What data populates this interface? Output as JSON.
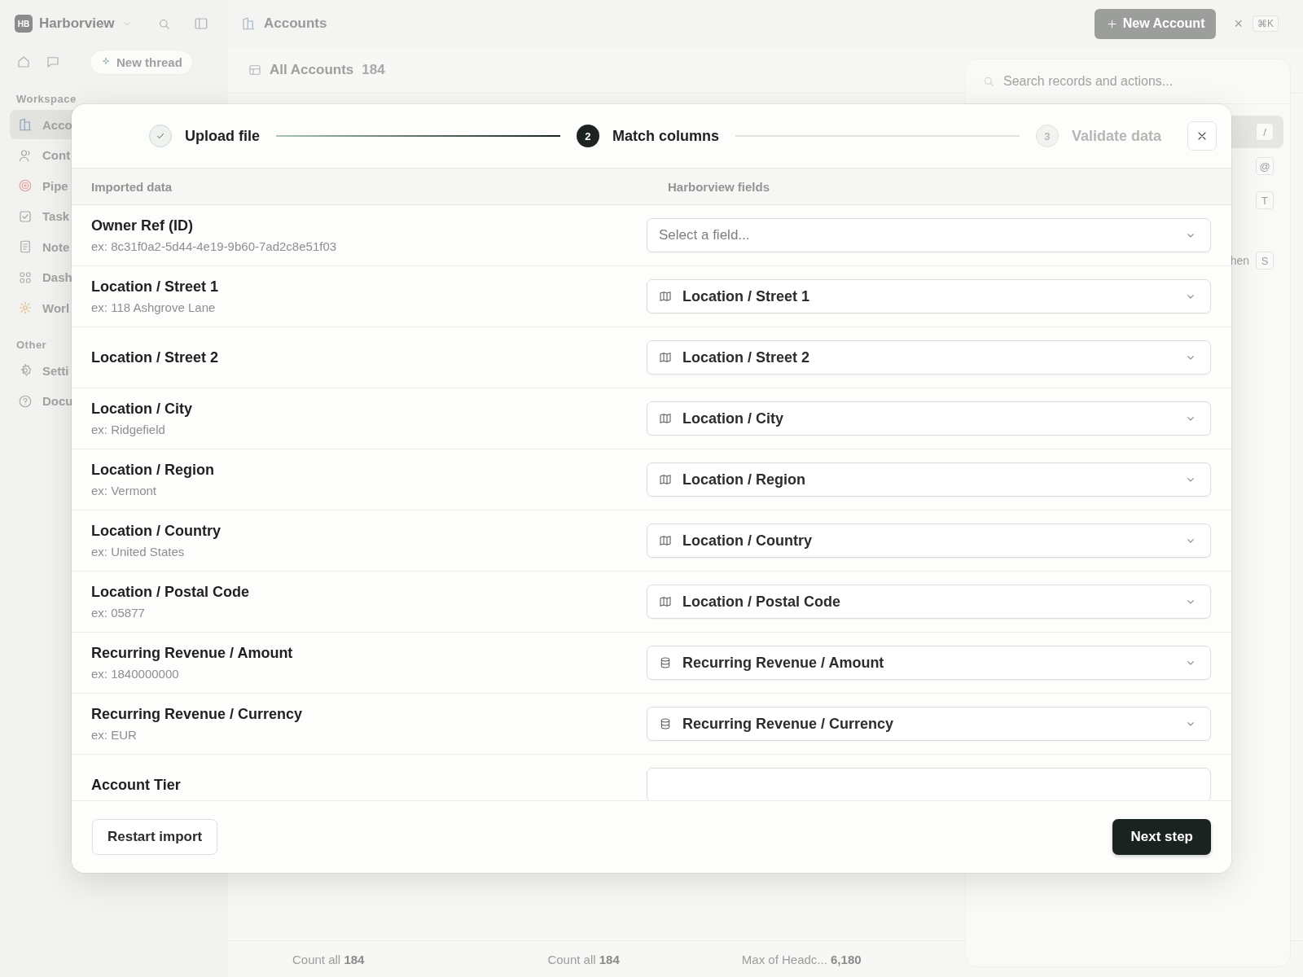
{
  "sidebar": {
    "logo": "HB",
    "workspace": "Harborview",
    "new_thread": "New thread",
    "sections": [
      {
        "title": "Workspace",
        "items": [
          {
            "label": "Acco",
            "selected": true
          },
          {
            "label": "Cont",
            "selected": false
          },
          {
            "label": "Pipe",
            "selected": false
          },
          {
            "label": "Task",
            "selected": false
          },
          {
            "label": "Note",
            "selected": false
          },
          {
            "label": "Dash",
            "selected": false
          },
          {
            "label": "Worl",
            "selected": false
          }
        ]
      },
      {
        "title": "Other",
        "items": [
          {
            "label": "Setti",
            "selected": false
          },
          {
            "label": "Docu",
            "selected": false
          }
        ]
      }
    ]
  },
  "topbar": {
    "title": "Accounts",
    "new_button": "New Account",
    "close": "×",
    "shortcut": "⌘K"
  },
  "view": {
    "title": "All Accounts",
    "count": "184",
    "footer": [
      {
        "label": "Count all",
        "value": "184"
      },
      {
        "label": "Count all",
        "value": "184"
      },
      {
        "label": "Max of Headc...",
        "value": "6,180"
      }
    ]
  },
  "command_panel": {
    "placeholder": "Search records and actions...",
    "shortcuts": [
      {
        "key": "/",
        "selected": true
      },
      {
        "key": "@",
        "selected": false
      },
      {
        "key": "T",
        "selected": false
      },
      {
        "label": "hen",
        "key": "S",
        "selected": false
      }
    ]
  },
  "import_modal": {
    "steps": [
      {
        "label": "Upload file",
        "completed": true,
        "selected": false
      },
      {
        "label": "Match columns",
        "completed": false,
        "selected": true,
        "number": "2"
      },
      {
        "label": "Validate data",
        "completed": false,
        "selected": false,
        "number": "3"
      }
    ],
    "columns": [
      "Imported data",
      "Harborview fields"
    ],
    "rows": [
      {
        "column": "Owner Ref (ID)",
        "example": "ex: 8c31f0a2-5d44-4e19-9b60-7ad2c8e51f03",
        "field": {
          "placeholder": "Select a field..."
        }
      },
      {
        "column": "Location / Street 1",
        "example": "ex: 118 Ashgrove Lane",
        "field": {
          "value": "Location / Street 1",
          "kind": "map"
        }
      },
      {
        "column": "Location / Street 2",
        "field": {
          "value": "Location / Street 2",
          "kind": "map"
        }
      },
      {
        "column": "Location / City",
        "example": "ex: Ridgefield",
        "field": {
          "value": "Location / City",
          "kind": "map"
        }
      },
      {
        "column": "Location / Region",
        "example": "ex: Vermont",
        "field": {
          "value": "Location / Region",
          "kind": "map"
        }
      },
      {
        "column": "Location / Country",
        "example": "ex: United States",
        "field": {
          "value": "Location / Country",
          "kind": "map"
        }
      },
      {
        "column": "Location / Postal Code",
        "example": "ex: 05877",
        "field": {
          "value": "Location / Postal Code",
          "kind": "map"
        }
      },
      {
        "column": "Recurring Revenue / Amount",
        "example": "ex: 1840000000",
        "field": {
          "value": "Recurring Revenue / Amount",
          "kind": "stack"
        }
      },
      {
        "column": "Recurring Revenue / Currency",
        "example": "ex: EUR",
        "field": {
          "value": "Recurring Revenue / Currency",
          "kind": "stack"
        }
      },
      {
        "column": "Account Tier"
      }
    ],
    "buttons": {
      "restart": "Restart import",
      "next": "Next step"
    }
  }
}
